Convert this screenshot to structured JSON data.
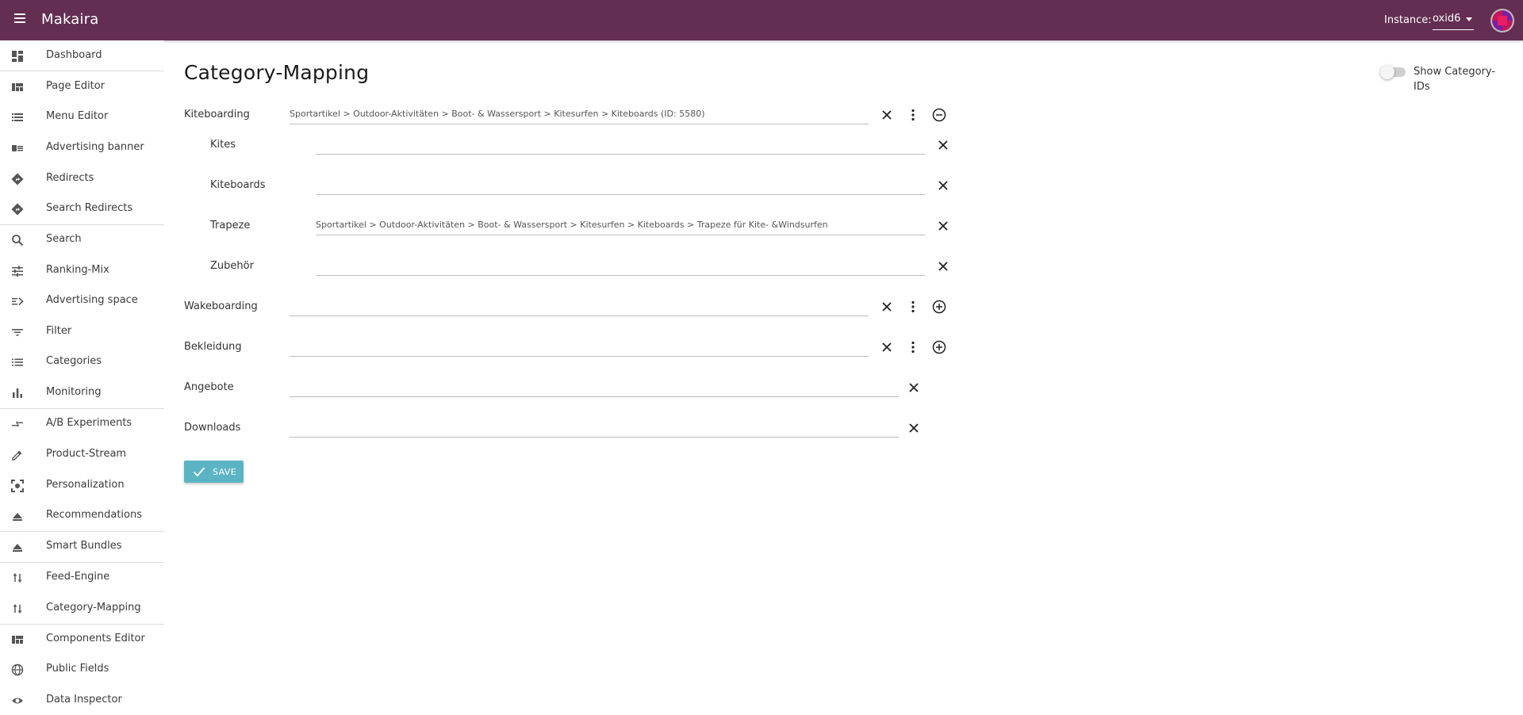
{
  "app": {
    "title": "Makaira"
  },
  "instance": {
    "label": "Instance:",
    "value": "oxid6"
  },
  "sidebar": {
    "items": [
      {
        "label": "Dashboard",
        "icon": "dashboard-icon"
      },
      {
        "label": "Page Editor",
        "icon": "page-editor-icon"
      },
      {
        "label": "Menu Editor",
        "icon": "menu-list-icon"
      },
      {
        "label": "Advertising banner",
        "icon": "banner-icon"
      },
      {
        "label": "Redirects",
        "icon": "directions-icon"
      },
      {
        "label": "Search Redirects",
        "icon": "directions-icon"
      },
      {
        "label": "Search",
        "icon": "search-icon"
      },
      {
        "label": "Ranking-Mix",
        "icon": "tune-icon"
      },
      {
        "label": "Advertising space",
        "icon": "ad-space-icon"
      },
      {
        "label": "Filter",
        "icon": "filter-icon"
      },
      {
        "label": "Categories",
        "icon": "list-icon"
      },
      {
        "label": "Monitoring",
        "icon": "bar-chart-icon"
      },
      {
        "label": "A/B Experiments",
        "icon": "compare-arrows-icon"
      },
      {
        "label": "Product-Stream",
        "icon": "pipette-icon"
      },
      {
        "label": "Personalization",
        "icon": "personalization-icon"
      },
      {
        "label": "Recommendations",
        "icon": "eject-icon"
      },
      {
        "label": "Smart Bundles",
        "icon": "eject-icon"
      },
      {
        "label": "Feed-Engine",
        "icon": "swap-vert-icon"
      },
      {
        "label": "Category-Mapping",
        "icon": "swap-vert-icon"
      },
      {
        "label": "Components Editor",
        "icon": "page-editor-icon"
      },
      {
        "label": "Public Fields",
        "icon": "globe-icon"
      },
      {
        "label": "Data Inspector",
        "icon": "eye-icon"
      }
    ]
  },
  "page": {
    "title": "Category-Mapping",
    "toggle_label": "Show Category-IDs",
    "toggle_on": false,
    "save_label": "SAVE"
  },
  "mappings": [
    {
      "label": "Kiteboarding",
      "value": "Sportartikel > Outdoor-Aktivitäten > Boot- & Wassersport > Kitesurfen > Kiteboards (ID: 5580)"
    },
    {
      "label": "Kites",
      "value": ""
    },
    {
      "label": "Kiteboards",
      "value": ""
    },
    {
      "label": "Trapeze",
      "value": "Sportartikel > Outdoor-Aktivitäten > Boot- & Wassersport > Kitesurfen > Kiteboards > Trapeze für Kite- &Windsurfen"
    },
    {
      "label": "Zubehör",
      "value": ""
    },
    {
      "label": "Wakeboarding",
      "value": ""
    },
    {
      "label": "Bekleidung",
      "value": ""
    },
    {
      "label": "Angebote",
      "value": ""
    },
    {
      "label": "Downloads",
      "value": ""
    }
  ],
  "colors": {
    "topbar": "#632e52",
    "accent": "#5bb4c4"
  }
}
